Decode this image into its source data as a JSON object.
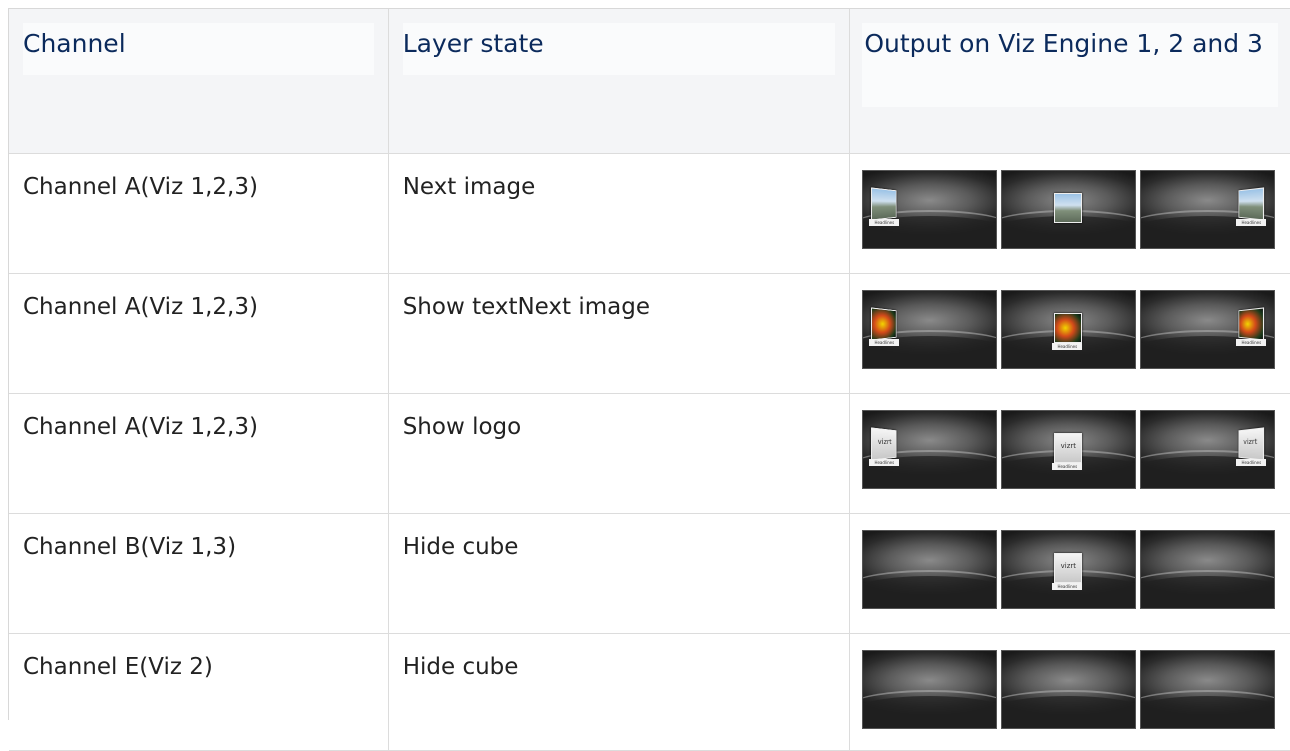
{
  "table": {
    "headers": {
      "channel": "Channel",
      "layer_state": "Layer state",
      "output": "Output on Viz Engine 1, 2 and 3"
    },
    "rows": [
      {
        "channel": "Channel A(Viz 1,2,3)",
        "layer_state": "Next image",
        "outputs": [
          "image-cube",
          "image-cube",
          "image-cube"
        ]
      },
      {
        "channel": "Channel A(Viz 1,2,3)",
        "layer_state": "Show textNext image",
        "outputs": [
          "text-cube",
          "text-cube",
          "text-cube"
        ]
      },
      {
        "channel": "Channel A(Viz 1,2,3)",
        "layer_state": "Show logo",
        "outputs": [
          "logo-cube",
          "logo-cube",
          "logo-cube"
        ]
      },
      {
        "channel": "Channel B(Viz 1,3)",
        "layer_state": "Hide cube",
        "outputs": [
          "empty",
          "logo-cube",
          "empty"
        ]
      },
      {
        "channel": "Channel E(Viz 2)",
        "layer_state": "Hide cube",
        "outputs": [
          "empty",
          "empty",
          "empty"
        ]
      }
    ]
  },
  "colors": {
    "header_text": "#0b2a5c",
    "header_bg": "#f4f5f7"
  }
}
